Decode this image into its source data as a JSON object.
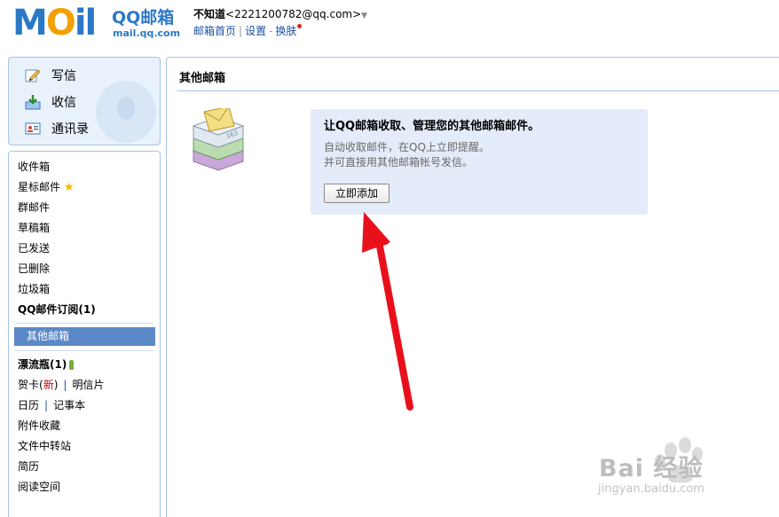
{
  "header": {
    "logo_letters": {
      "m": "M",
      "o": "O",
      "il": "il"
    },
    "product_name": "QQ邮箱",
    "domain": "mail.qq.com",
    "user_name": "不知道",
    "user_email": "<2221200782@qq.com>",
    "user_menu_caret": "▼",
    "links": {
      "home": "邮箱首页",
      "divider": "|",
      "settings": "设置",
      "dash": "-",
      "skin": "换肤"
    }
  },
  "sidebar": {
    "quick_actions": {
      "write": "写信",
      "receive": "收信",
      "contacts": "通讯录"
    },
    "folders": {
      "inbox": "收件箱",
      "starred": "星标邮件",
      "group": "群邮件",
      "drafts": "草稿箱",
      "sent": "已发送",
      "deleted": "已删除",
      "spam": "垃圾箱",
      "subscriptions": "QQ邮件订阅(1)",
      "other_mailboxes": "其他邮箱",
      "drift_bottle": "漂流瓶(1)",
      "greeting_card": "贺卡(",
      "greeting_card_new": "新",
      "greeting_card_close": ")",
      "postcard": "明信片",
      "calendar": "日历",
      "notepad": "记事本",
      "attachments": "附件收藏",
      "file_transfer": "文件中转站",
      "resume": "简历",
      "reading_space": "阅读空间",
      "pipe": "|"
    }
  },
  "main": {
    "title": "其他邮箱",
    "promo": {
      "title": "让QQ邮箱收取、管理您的其他邮箱邮件。",
      "desc_line1": "自动收取邮件，在QQ上立即提醒。",
      "desc_line2": "并可直接用其他邮箱帐号发信。",
      "button": "立即添加"
    }
  },
  "watermark": {
    "brand": "Bai 经验",
    "url": "jingyan.baidu.com"
  },
  "colors": {
    "brand_blue": "#2a78c6",
    "link_blue": "#1e50a2",
    "selected_bg": "#5b88c6",
    "promo_bg": "#e3ecf8",
    "arrow_red": "#e8101a"
  },
  "icons": {
    "write": "pencil-icon",
    "receive": "download-icon",
    "contacts": "address-card-icon",
    "starred": "star-icon",
    "drift_bottle": "bottle-icon",
    "mailbox_stack": "mail-stack-icon",
    "annotation": "red-arrow-icon"
  }
}
